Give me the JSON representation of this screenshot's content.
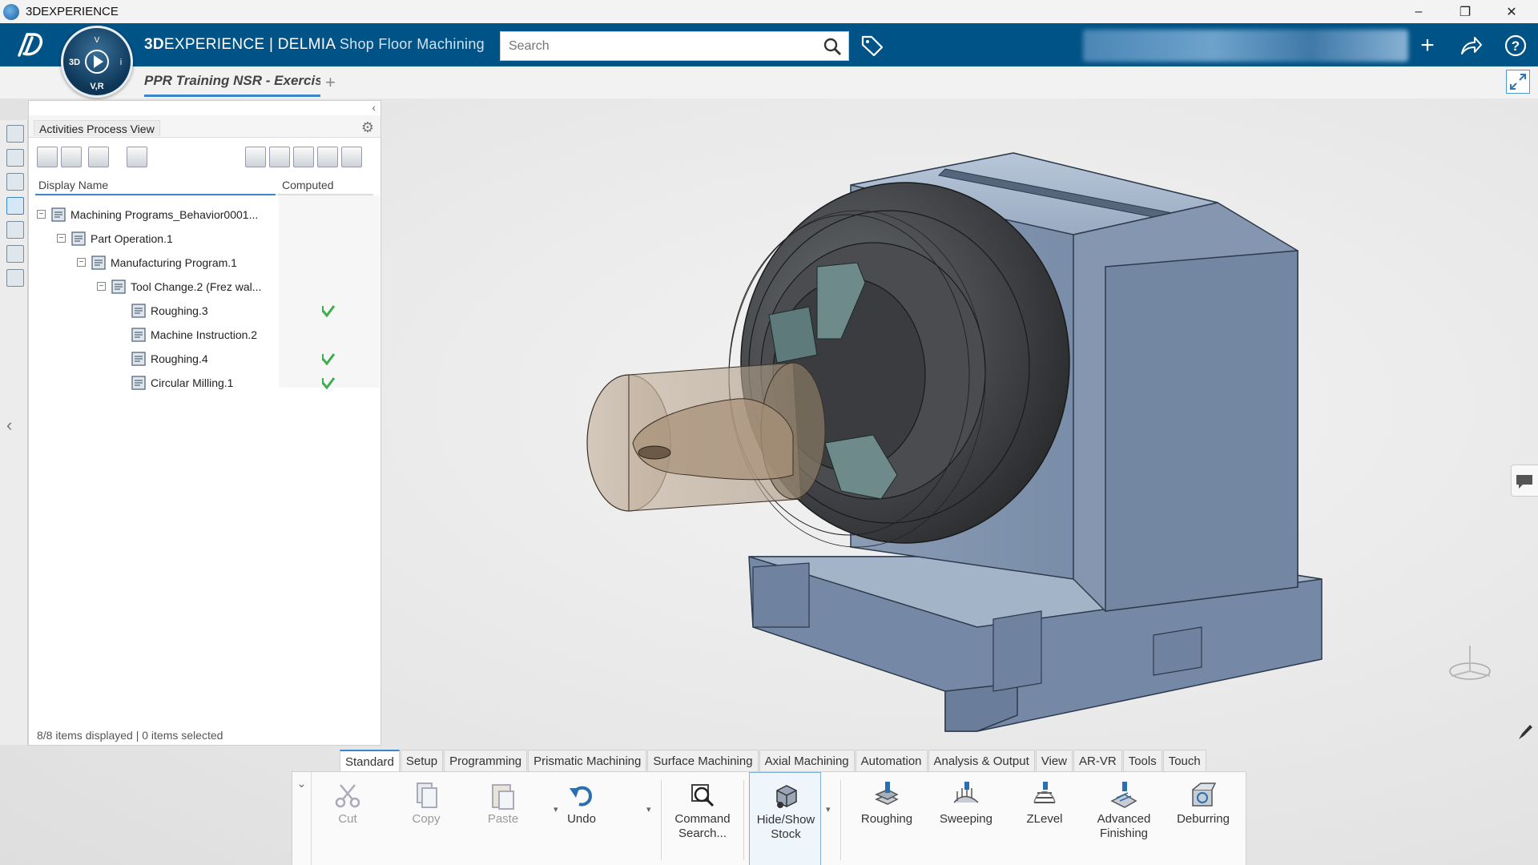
{
  "window": {
    "title": "3DEXPERIENCE",
    "minimize": "–",
    "restore": "❐",
    "close": "✕"
  },
  "header": {
    "brand_prefix": "3D",
    "brand_main": "EXPERIENCE | DELMIA",
    "app_name": "Shop Floor Machining",
    "search_placeholder": "Search",
    "add_label": "+",
    "share_label": "↪",
    "help_label": "?",
    "colors": {
      "bar": "#005386",
      "accent": "#3a86c8"
    }
  },
  "compass": {
    "top_label": "V",
    "left_label": "3D",
    "bottom_label": "V,R",
    "right_label": "i"
  },
  "tabs": {
    "active_tab": "PPR Training NSR - Exercis",
    "add_tab": "+"
  },
  "panel": {
    "title": "Activities Process View",
    "columns": {
      "name": "Display Name",
      "computed": "Computed"
    },
    "tree": [
      {
        "label": "Machining Programs_Behavior0001...",
        "level": 0,
        "expander": "−",
        "icon": "program-list-icon",
        "computed": false
      },
      {
        "label": "Part Operation.1",
        "level": 1,
        "expander": "−",
        "icon": "part-operation-icon",
        "computed": false
      },
      {
        "label": "Manufacturing Program.1",
        "level": 2,
        "expander": "−",
        "icon": "manufacturing-program-icon",
        "computed": false
      },
      {
        "label": "Tool Change.2 (Frez wal...",
        "level": 3,
        "expander": "−",
        "icon": "tool-change-icon",
        "computed": false
      },
      {
        "label": "Roughing.3",
        "level": 4,
        "expander": "",
        "icon": "roughing-icon",
        "computed": true
      },
      {
        "label": "Machine Instruction.2",
        "level": 4,
        "expander": "",
        "icon": "machine-instruction-icon",
        "computed": false
      },
      {
        "label": "Roughing.4",
        "level": 4,
        "expander": "",
        "icon": "roughing-icon",
        "computed": true
      },
      {
        "label": "Circular Milling.1",
        "level": 4,
        "expander": "",
        "icon": "circular-milling-icon",
        "computed": true
      }
    ],
    "status": "8/8 items displayed | 0 items selected"
  },
  "action_bar": {
    "tabs": [
      "Standard",
      "Setup",
      "Programming",
      "Prismatic Machining",
      "Surface Machining",
      "Axial Machining",
      "Automation",
      "Analysis & Output",
      "View",
      "AR-VR",
      "Tools",
      "Touch"
    ],
    "active_tab": "Standard",
    "commands": {
      "cut": "Cut",
      "copy": "Copy",
      "paste": "Paste",
      "undo": "Undo",
      "command_search": "Command Search...",
      "hide_show_stock": "Hide/Show Stock",
      "roughing": "Roughing",
      "sweeping": "Sweeping",
      "zlevel": "ZLevel",
      "advanced_finishing": "Advanced Finishing",
      "deburring": "Deburring"
    }
  }
}
